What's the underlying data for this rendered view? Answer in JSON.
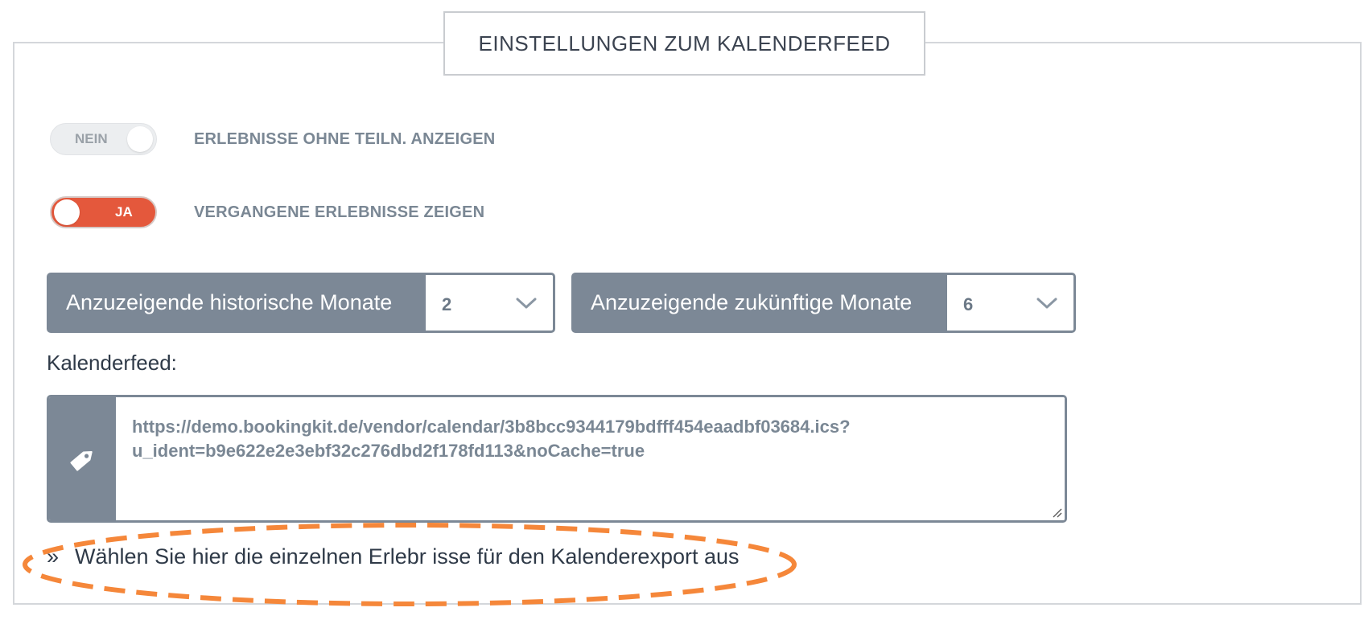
{
  "panel": {
    "title": "EINSTELLUNGEN ZUM KALENDERFEED"
  },
  "toggles": [
    {
      "state": "NEIN",
      "on": false,
      "label": "ERLEBNISSE OHNE TEILN. ANZEIGEN"
    },
    {
      "state": "JA",
      "on": true,
      "label": "VERGANGENE ERLEBNISSE ZEIGEN"
    }
  ],
  "history_months": {
    "label": "Anzuzeigende historische Monate",
    "value": "2"
  },
  "future_months": {
    "label": "Anzuzeigende zukünftige Monate",
    "value": "6"
  },
  "feed": {
    "label": "Kalenderfeed:",
    "url_line1": "https://demo.bookingkit.de/vendor/calendar/3b8bcc9344179bdfff454eaadbf03684.ics?",
    "url_line2": "u_ident=b9e622e2e3ebf32c276dbd2f178fd113&noCache=true",
    "icon": "tag-icon"
  },
  "export_link": {
    "prefix": "»",
    "text": "Wählen Sie hier die einzelnen Erlebr isse für den Kalenderexport aus"
  },
  "colors": {
    "toggle_on": "#e4583c",
    "addon_gray": "#7c8896",
    "highlight_orange": "#f5873a"
  }
}
